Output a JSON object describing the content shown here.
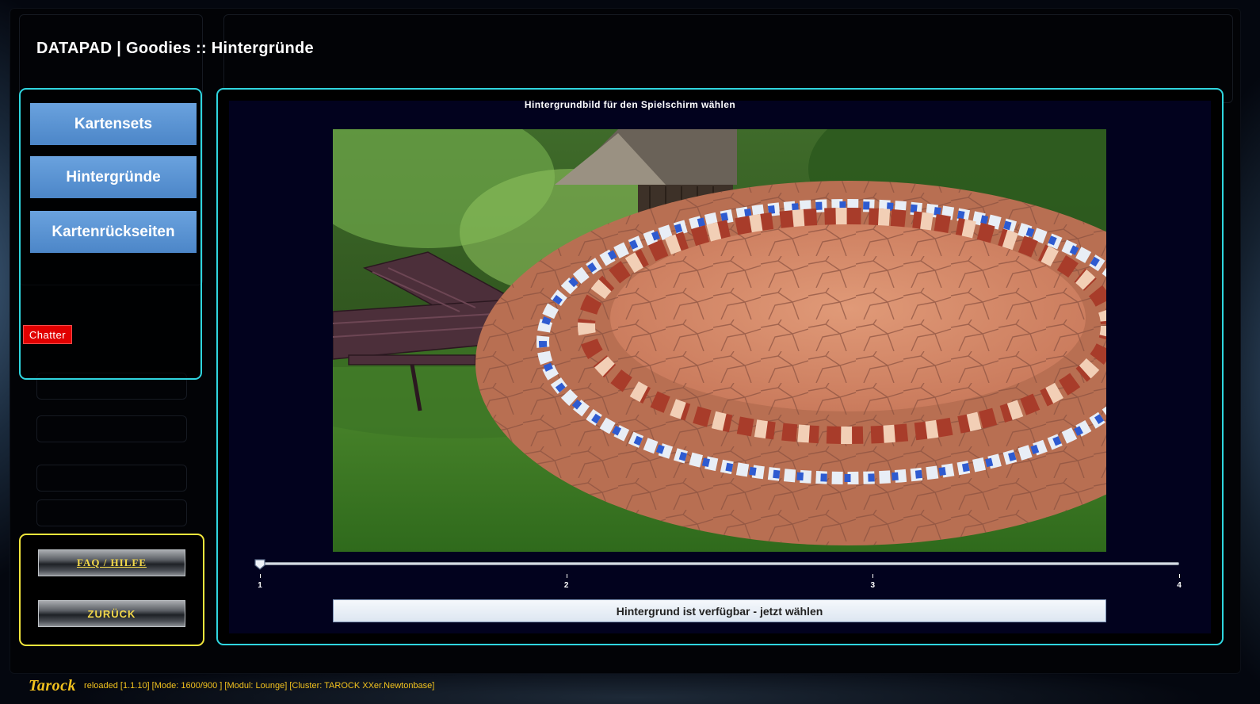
{
  "window": {
    "title": "DATAPAD | Goodies :: Hintergründe"
  },
  "menu": {
    "items": [
      {
        "label": "Kartensets"
      },
      {
        "label": "Hintergründe"
      },
      {
        "label": "Kartenrückseiten"
      }
    ],
    "chatter_label": "Chatter"
  },
  "bottom": {
    "faq_label": "FAQ / HILFE",
    "back_label": "ZURÜCK"
  },
  "main": {
    "caption": "Hintergrundbild für den Spielschirm wählen",
    "preview_icon": "mosaic-table-garden-image",
    "slider": {
      "min": 1,
      "max": 4,
      "value": 1,
      "tick_labels": [
        "1",
        "2",
        "3",
        "4"
      ]
    },
    "choose_label": "Hintergrund ist verfügbar - jetzt wählen"
  },
  "status_bar": {
    "logo": "Tarock",
    "text": "reloaded [1.1.10] [Mode: 1600/900 ] [Modul: Lounge] [Cluster: TAROCK XXer.Newtonbase]"
  },
  "colors": {
    "panel_border": "#2fd6e0",
    "accent_yellow": "#f2e63c",
    "menu_button": "#5b95d4",
    "chatter_red": "#e10000",
    "status_text": "#f2c21e"
  }
}
